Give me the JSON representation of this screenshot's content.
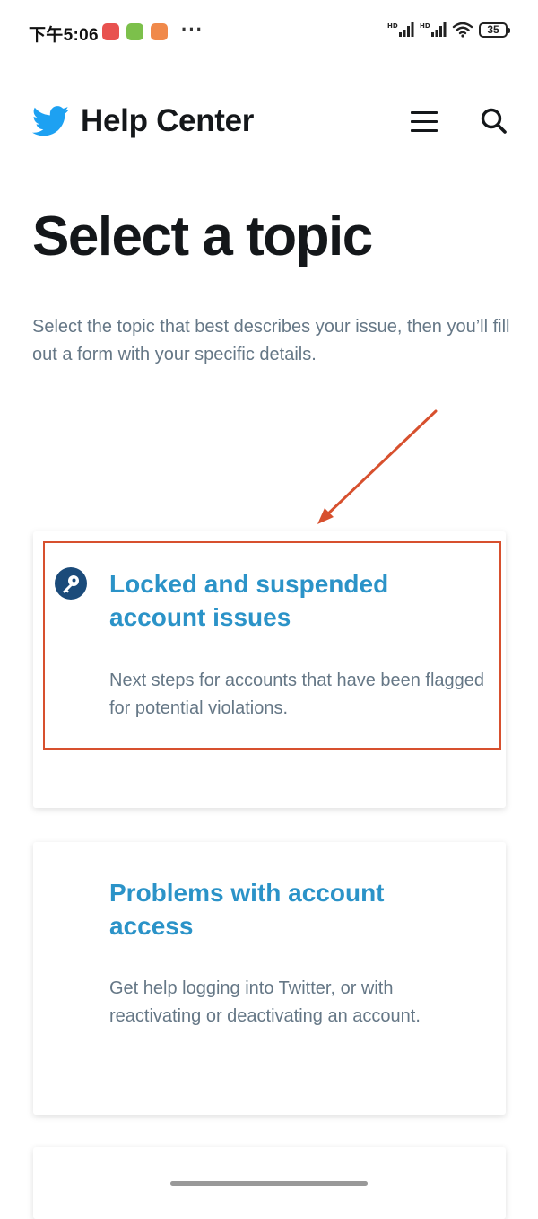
{
  "status_bar": {
    "time": "下午5:06",
    "more": "···",
    "battery_level": "35"
  },
  "header": {
    "title": "Help Center",
    "logo_icon": "twitter-bird-icon",
    "menu_icon": "hamburger-menu-icon",
    "search_icon": "search-icon"
  },
  "page": {
    "title": "Select a topic",
    "intro": "Select the topic that best describes your issue, then you’ll fill out a form with your specific details."
  },
  "topics": [
    {
      "title": "Locked and suspended account issues",
      "description": "Next steps for accounts that have been flagged for potential violations.",
      "icon": "key-icon",
      "highlighted": true
    },
    {
      "title": "Problems with account access",
      "description": "Get help logging into Twitter, or with reactivating or deactivating an account."
    }
  ],
  "colors": {
    "brand": "#1da1f2",
    "link": "#2b93c8",
    "annotation": "#d7502e",
    "text_secondary": "#657786"
  }
}
